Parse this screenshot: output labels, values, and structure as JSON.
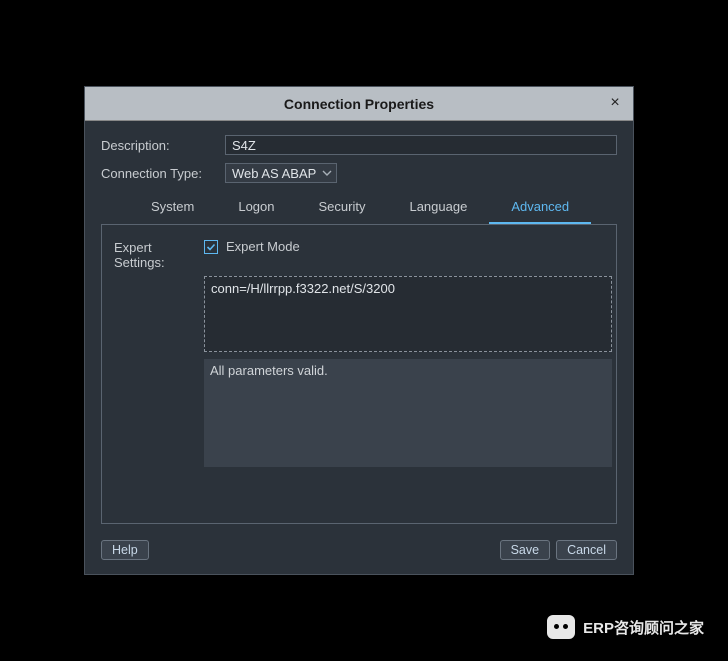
{
  "dialog": {
    "title": "Connection Properties",
    "close": "×"
  },
  "form": {
    "description_label": "Description:",
    "description_value": "S4Z",
    "conntype_label": "Connection Type:",
    "conntype_value": "Web AS ABAP"
  },
  "tabs": {
    "system": "System",
    "logon": "Logon",
    "security": "Security",
    "language": "Language",
    "advanced": "Advanced"
  },
  "expert": {
    "settings_label": "Expert Settings:",
    "mode_label": "Expert Mode",
    "conn_string": "conn=/H/llrrpp.f3322.net/S/3200",
    "validation": "All parameters valid."
  },
  "buttons": {
    "help": "Help",
    "save": "Save",
    "cancel": "Cancel"
  },
  "watermark": {
    "text": "ERP咨询顾问之家"
  }
}
